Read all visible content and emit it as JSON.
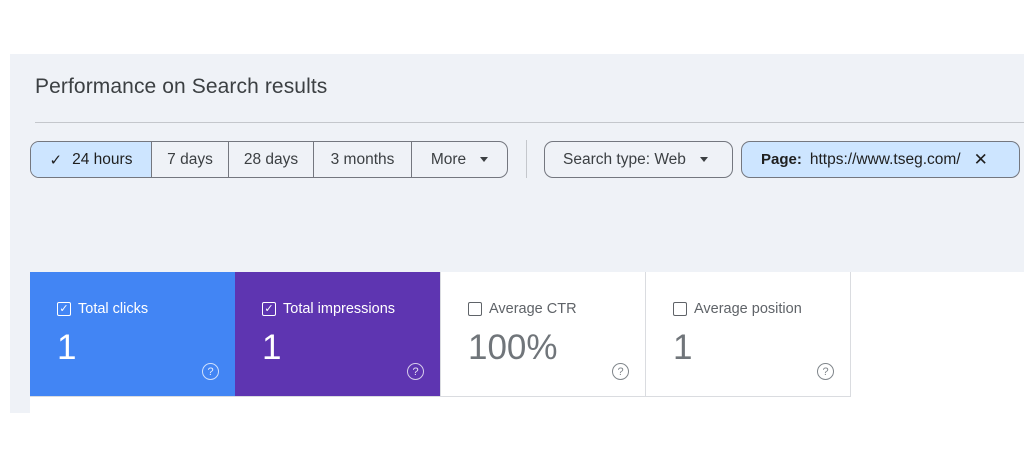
{
  "header": {
    "title": "Performance on Search results"
  },
  "date_range": {
    "options": [
      {
        "label": "24 hours",
        "selected": true
      },
      {
        "label": "7 days",
        "selected": false
      },
      {
        "label": "28 days",
        "selected": false
      },
      {
        "label": "3 months",
        "selected": false
      },
      {
        "label": "More",
        "selected": false
      }
    ]
  },
  "filters": {
    "search_type": "Search type: Web",
    "page_label": "Page:",
    "page_value": "https://www.tseg.com/"
  },
  "metrics": [
    {
      "label": "Total clicks",
      "value": "1",
      "checked": true,
      "color": "#4285f4"
    },
    {
      "label": "Total impressions",
      "value": "1",
      "checked": true,
      "color": "#5e35b1"
    },
    {
      "label": "Average CTR",
      "value": "100%",
      "checked": false,
      "color": "#ffffff"
    },
    {
      "label": "Average position",
      "value": "1",
      "checked": false,
      "color": "#ffffff"
    }
  ],
  "icons": {
    "check": "check-icon",
    "caret": "arrow-drop-down-icon",
    "close": "close-icon",
    "help": "help-circle-icon"
  }
}
